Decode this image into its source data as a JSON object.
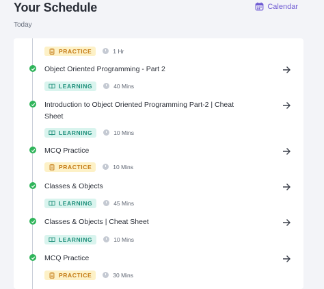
{
  "header": {
    "title": "Your Schedule",
    "calendar_label": "Calendar",
    "subtitle": "Today"
  },
  "colors": {
    "accent": "#6f5bd3",
    "done": "#2fb45a",
    "practice_bg": "#fdf1c7",
    "practice_fg": "#c47a14",
    "learning_bg": "#d9f4ee",
    "learning_fg": "#1d8f7a"
  },
  "items": [
    {
      "title": "",
      "type": "PRACTICE",
      "duration": "1 Hr"
    },
    {
      "title": "Object Oriented Programming - Part 2",
      "type": "LEARNING",
      "duration": "40 Mins"
    },
    {
      "title": "Introduction to Object Oriented Programming Part-2 | Cheat Sheet",
      "type": "LEARNING",
      "duration": "10 Mins"
    },
    {
      "title": "MCQ Practice",
      "type": "PRACTICE",
      "duration": "10 Mins"
    },
    {
      "title": "Classes & Objects",
      "type": "LEARNING",
      "duration": "45 Mins"
    },
    {
      "title": "Classes & Objects | Cheat Sheet",
      "type": "LEARNING",
      "duration": "10 Mins"
    },
    {
      "title": "MCQ Practice",
      "type": "PRACTICE",
      "duration": "30 Mins"
    }
  ]
}
